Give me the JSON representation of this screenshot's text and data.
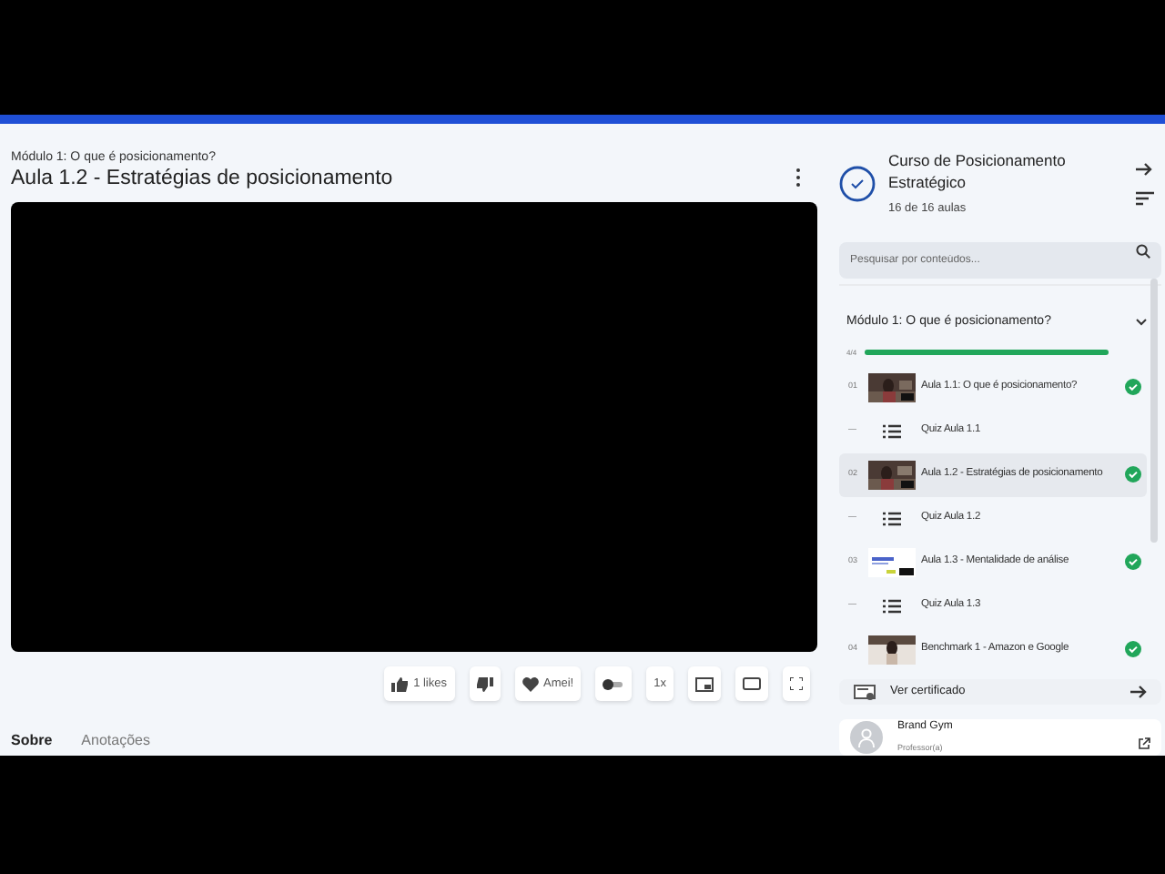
{
  "module_label": "Módulo 1: O que é posicionamento?",
  "lesson_title": "Aula 1.2 - Estratégias de posicionamento",
  "actions": [
    {
      "kind": "like",
      "label": "1 likes"
    },
    {
      "kind": "dislike"
    },
    {
      "kind": "love",
      "label": "Amei!"
    },
    {
      "kind": "autoplay",
      "on": false
    },
    {
      "kind": "speed",
      "label": "1x"
    },
    {
      "kind": "pip"
    },
    {
      "kind": "theater"
    },
    {
      "kind": "fullscreen"
    }
  ],
  "tabs": [
    {
      "label": "Sobre",
      "selected": true
    },
    {
      "label": "Anotações",
      "selected": false
    }
  ],
  "course": {
    "title": "Curso de Posicionamento Estratégico",
    "progress_text": "16 de 16 aulas",
    "completed": true
  },
  "search": {
    "placeholder": "Pesquisar por conteúdos..."
  },
  "module": {
    "title": "Módulo 1: O que é posicionamento?",
    "expanded": true,
    "progress_text": "4/4",
    "level": 1.0
  },
  "items": [
    {
      "kind": "video",
      "number": "01",
      "title": "Aula 1.1: O que é posicionamento?",
      "completed": true,
      "selected": false
    },
    {
      "kind": "quiz",
      "number": "—",
      "title": "Quiz Aula 1.1",
      "completed": false,
      "selected": false
    },
    {
      "kind": "video",
      "number": "02",
      "title": "Aula 1.2 - Estratégias de posicionamento",
      "completed": true,
      "selected": true
    },
    {
      "kind": "quiz",
      "number": "—",
      "title": "Quiz Aula 1.2",
      "completed": false,
      "selected": false
    },
    {
      "kind": "video",
      "number": "03",
      "title": "Aula 1.3 - Mentalidade de análise",
      "completed": true,
      "selected": false
    },
    {
      "kind": "quiz",
      "number": "—",
      "title": "Quiz Aula 1.3",
      "completed": false,
      "selected": false
    },
    {
      "kind": "video",
      "number": "04",
      "title": "Benchmark 1 - Amazon e Google",
      "completed": true,
      "selected": false
    }
  ],
  "certificate": {
    "label": "Ver certificado"
  },
  "instructor": {
    "name": "Brand Gym",
    "role": "Professor(a)"
  }
}
